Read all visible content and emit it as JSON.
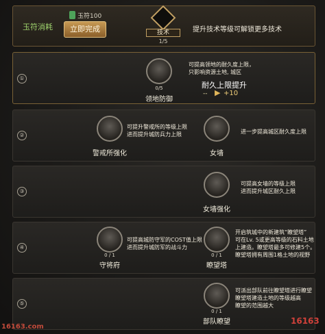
{
  "header": {
    "cost_label": "玉符消耗",
    "jade": "玉符100",
    "finish_button": "立即完成",
    "tech_name": "技术",
    "tech_progress": "1/5",
    "description": "提升技术等级可解锁更多技术"
  },
  "rows": [
    {
      "number": "①",
      "nodes": [
        {
          "name": "领地防御",
          "progress": "0/5",
          "desc": [
            "可提高领地的耐久度上限，",
            "只影响资源土地, 城区"
          ],
          "effect_title": "耐久上限提升",
          "effect_from": "--",
          "effect_to": "+10"
        }
      ]
    },
    {
      "number": "②",
      "nodes": [
        {
          "name": "警戒所强化",
          "progress": "",
          "desc": [
            "可提升警戒所的等级上限",
            "进而提升城防兵力上限"
          ]
        },
        {
          "name": "女墙",
          "progress": "",
          "desc": [
            "进一步提高城区耐久度上限"
          ]
        }
      ]
    },
    {
      "number": "③",
      "nodes": [
        {
          "name": "女墙强化",
          "progress": "",
          "desc": [
            "可提高女墙的等级上限",
            "进而提升城区耐久上限"
          ]
        }
      ]
    },
    {
      "number": "④",
      "nodes": [
        {
          "name": "守将府",
          "progress": "0 / 1",
          "desc": [
            "可提高城防守军的COST值上限",
            "进而提升城防军的战斗力"
          ]
        },
        {
          "name": "瞭望塔",
          "progress": "0 / 1",
          "desc": [
            "开启筑城中的新建筑“瞭望塔”",
            "可在Lv. 5或更高等级的石料土地",
            "上建造。瞭望塔最多可修建5个。",
            "瞭望塔拥有周围1格土地的视野"
          ]
        }
      ]
    },
    {
      "number": "⑤",
      "nodes": [
        {
          "name": "部队瞭望",
          "progress": "0 / 1",
          "desc": [
            "可派出部队前往瞭望塔进行瞭望",
            "瞭望塔建造土地的等级越高",
            "瞭望的范围越大"
          ]
        }
      ]
    }
  ],
  "watermark": {
    "left": "16163.com",
    "right": "16163"
  }
}
